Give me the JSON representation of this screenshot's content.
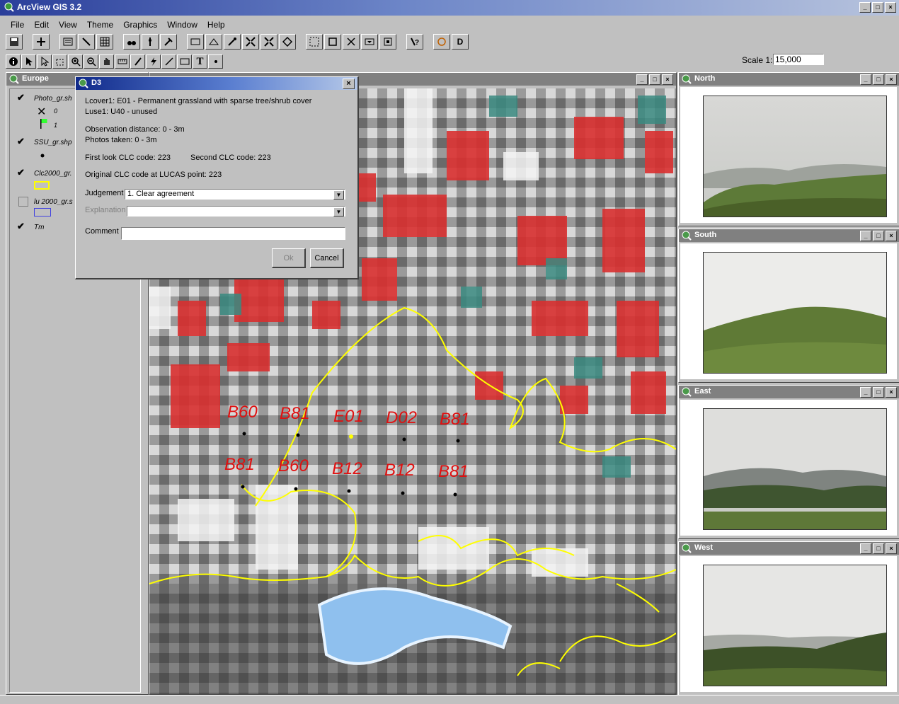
{
  "app": {
    "title": "ArcView GIS 3.2"
  },
  "menu": [
    {
      "label": "File"
    },
    {
      "label": "Edit"
    },
    {
      "label": "View"
    },
    {
      "label": "Theme"
    },
    {
      "label": "Graphics"
    },
    {
      "label": "Window"
    },
    {
      "label": "Help"
    }
  ],
  "scale": {
    "label": "Scale 1:",
    "value": "15,000"
  },
  "europe_view": {
    "title": "Europe",
    "themes": [
      {
        "label": "Photo_gr.sh",
        "checked": true,
        "legend": [
          {
            "symbol": "X",
            "text": "0"
          },
          {
            "symbol": "flag",
            "text": "1"
          }
        ]
      },
      {
        "label": "SSU_gr.shp",
        "checked": true
      },
      {
        "label": "Clc2000_gr.",
        "checked": true
      },
      {
        "label": "lu 2000_gr.s",
        "checked": false
      },
      {
        "label": "Tm",
        "checked": true
      }
    ]
  },
  "dialog": {
    "title": "D3",
    "lcover": "Lcover1: E01 - Permanent grassland with sparse tree/shrub cover",
    "luse": "Luse1: U40 - unused",
    "obs_distance": "Observation distance: 0 - 3m",
    "photos_taken": "Photos taken: 0 - 3m",
    "first_look": "First look CLC code: 223",
    "second_clc": "Second CLC code: 223",
    "original_clc": "Original CLC code at LUCAS point: 223",
    "judgement_label": "Judgement",
    "judgement_value": "1. Clear agreement",
    "explanation_label": "Explanation",
    "explanation_value": "",
    "comment_label": "Comment",
    "comment_value": "",
    "ok_label": "Ok",
    "cancel_label": "Cancel"
  },
  "map": {
    "labels_row1": [
      "B60",
      "B81",
      "E01",
      "D02",
      "B81"
    ],
    "labels_row2": [
      "B81",
      "B60",
      "B12",
      "B12",
      "B81"
    ]
  },
  "photos": [
    {
      "title": "North"
    },
    {
      "title": "South"
    },
    {
      "title": "East"
    },
    {
      "title": "West"
    }
  ],
  "window_controls": {
    "minimize": "_",
    "maximize": "□",
    "close": "×"
  },
  "colors": {
    "title_active": "#2a3e9a",
    "title_inactive": "#808080",
    "map_label": "#e01010",
    "polygon": "#ffff00"
  }
}
